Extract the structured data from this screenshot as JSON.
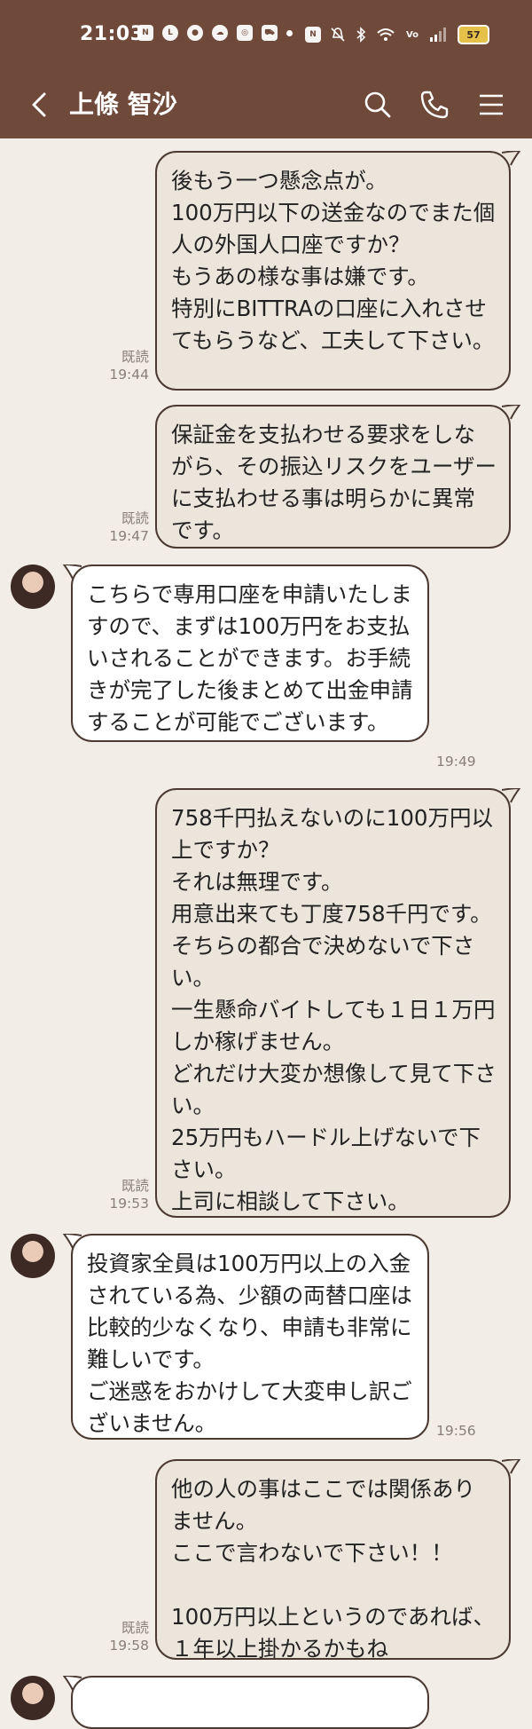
{
  "status_bar": {
    "time": "21:03",
    "battery": "57",
    "left_icons": [
      "netflix-icon",
      "line-icon",
      "chat-icon",
      "weather-icon",
      "instagram-icon",
      "shopping-icon"
    ],
    "right_icons": [
      "nfc-icon",
      "mute-icon",
      "bluetooth-icon",
      "wifi-icon",
      "volte-icon",
      "signal-icon"
    ]
  },
  "header": {
    "contact_name": "上條 智沙"
  },
  "messages": [
    {
      "dir": "out",
      "text": "後もう一つ懸念点が。\n100万円以下の送金なのでまた個人の外国人口座ですか？\nもうあの様な事は嫌です。\n特別にBITTRAの口座に入れさせてもらうなど、工夫して下さい。",
      "read": "既読",
      "time": "19:44"
    },
    {
      "dir": "out",
      "text": "保証金を支払わせる要求をしながら、その振込リスクをユーザーに支払わせる事は明らかに異常です。",
      "read": "既読",
      "time": "19:47"
    },
    {
      "dir": "in",
      "text": "こちらで専用口座を申請いたしますので、まずは100万円をお支払いされることができます。お手続きが完了した後まとめて出金申請することが可能でございます。",
      "time": "19:49"
    },
    {
      "dir": "out",
      "text": "758千円払えないのに100万円以上ですか？\nそれは無理です。\n用意出来ても丁度758千円です。\nそちらの都合で決めないで下さい。\n一生懸命バイトしても１日１万円しか稼げません。\nどれだけ大変か想像して見て下さい。\n25万円もハードル上げないで下さい。\n上司に相談して下さい。",
      "read": "既読",
      "time": "19:53"
    },
    {
      "dir": "in",
      "text": "投資家全員は100万円以上の入金されている為、少額の両替口座は比較的少なくなり、申請も非常に難しいです。\nご迷惑をおかけして大変申し訳ございません。",
      "time": "19:56"
    },
    {
      "dir": "out",
      "text": "他の人の事はここでは関係ありません。\nここで言わないで下さい！！\n\n100万円以上というのであれば、１年以上掛かるかもね",
      "read": "既読",
      "time": "19:58"
    },
    {
      "dir": "in",
      "text": "",
      "time": ""
    }
  ]
}
